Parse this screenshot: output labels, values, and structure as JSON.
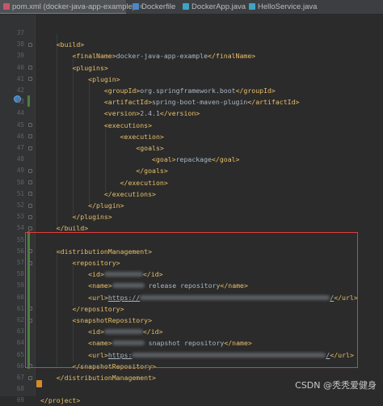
{
  "tabs": [
    {
      "label": "pom.xml (docker-java-app-example)",
      "icon": "maven-icon",
      "color": "#c7566b",
      "active": true
    },
    {
      "label": "Dockerfile",
      "icon": "docker-icon",
      "color": "#4a88c7",
      "active": false
    },
    {
      "label": "DockerApp.java",
      "icon": "java-class-icon",
      "color": "#3fa3c6",
      "active": false
    },
    {
      "label": "HelloService.java",
      "icon": "java-class-icon",
      "color": "#3fa3c6",
      "active": false
    }
  ],
  "close_glyph": "×",
  "editor": {
    "lines": [
      {
        "n": "37",
        "parts": []
      },
      {
        "n": "38",
        "parts": [
          {
            "t": "    "
          },
          {
            "tag": "<build>"
          }
        ]
      },
      {
        "n": "39",
        "parts": [
          {
            "t": "        "
          },
          {
            "tag": "<finalName>"
          },
          {
            "t": "docker-java-app-example"
          },
          {
            "tag": "</finalName>"
          }
        ]
      },
      {
        "n": "40",
        "parts": [
          {
            "t": "        "
          },
          {
            "tag": "<plugins>"
          }
        ]
      },
      {
        "n": "41",
        "parts": [
          {
            "t": "            "
          },
          {
            "tag": "<plugin>"
          }
        ]
      },
      {
        "n": "42",
        "parts": [
          {
            "t": "                "
          },
          {
            "tag": "<groupId>"
          },
          {
            "t": "org.springframework.boot"
          },
          {
            "tag": "</groupId>"
          }
        ]
      },
      {
        "n": "43",
        "parts": [
          {
            "t": "                "
          },
          {
            "tag": "<artifactId>"
          },
          {
            "t": "spring-boot-maven-plugin"
          },
          {
            "tag": "</artifactId>"
          }
        ]
      },
      {
        "n": "44",
        "parts": [
          {
            "t": "                "
          },
          {
            "tag": "<version>"
          },
          {
            "t": "2.4.1"
          },
          {
            "tag": "</version>"
          }
        ]
      },
      {
        "n": "45",
        "parts": [
          {
            "t": "                "
          },
          {
            "tag": "<executions>"
          }
        ]
      },
      {
        "n": "46",
        "parts": [
          {
            "t": "                    "
          },
          {
            "tag": "<execution>"
          }
        ]
      },
      {
        "n": "47",
        "parts": [
          {
            "t": "                        "
          },
          {
            "tag": "<goals>"
          }
        ]
      },
      {
        "n": "48",
        "parts": [
          {
            "t": "                            "
          },
          {
            "tag": "<goal>"
          },
          {
            "t": "repackage"
          },
          {
            "tag": "</goal>"
          }
        ]
      },
      {
        "n": "49",
        "parts": [
          {
            "t": "                        "
          },
          {
            "tag": "</goals>"
          }
        ]
      },
      {
        "n": "50",
        "parts": [
          {
            "t": "                    "
          },
          {
            "tag": "</execution>"
          }
        ]
      },
      {
        "n": "51",
        "parts": [
          {
            "t": "                "
          },
          {
            "tag": "</executions>"
          }
        ]
      },
      {
        "n": "52",
        "parts": [
          {
            "t": "            "
          },
          {
            "tag": "</plugin>"
          }
        ]
      },
      {
        "n": "53",
        "parts": [
          {
            "t": "        "
          },
          {
            "tag": "</plugins>"
          }
        ]
      },
      {
        "n": "54",
        "parts": [
          {
            "t": "    "
          },
          {
            "tag": "</build>"
          }
        ]
      },
      {
        "n": "55",
        "parts": []
      },
      {
        "n": "56",
        "parts": [
          {
            "t": "    "
          },
          {
            "tag": "<distributionManagement>"
          }
        ]
      },
      {
        "n": "57",
        "parts": [
          {
            "t": "        "
          },
          {
            "tag": "<repository>"
          }
        ]
      },
      {
        "n": "58",
        "parts": [
          {
            "t": "            "
          },
          {
            "tag": "<id>"
          },
          {
            "blur": 48
          },
          {
            "tag": "</id>"
          }
        ]
      },
      {
        "n": "59",
        "parts": [
          {
            "t": "            "
          },
          {
            "tag": "<name>"
          },
          {
            "blur": 40
          },
          {
            "t": " release repository"
          },
          {
            "tag": "</name>"
          }
        ]
      },
      {
        "n": "60",
        "parts": [
          {
            "t": "            "
          },
          {
            "tag": "<url>"
          },
          {
            "t": "https://",
            "u": true
          },
          {
            "blur": 235
          },
          {
            "t": "/",
            "u": true
          },
          {
            "tag": "</url>"
          }
        ]
      },
      {
        "n": "61",
        "parts": [
          {
            "t": "        "
          },
          {
            "tag": "</repository>"
          }
        ]
      },
      {
        "n": "62",
        "parts": [
          {
            "t": "        "
          },
          {
            "tag": "<snapshotRepository>"
          }
        ]
      },
      {
        "n": "63",
        "parts": [
          {
            "t": "            "
          },
          {
            "tag": "<id>"
          },
          {
            "blur": 48
          },
          {
            "tag": "</id>"
          }
        ]
      },
      {
        "n": "64",
        "parts": [
          {
            "t": "            "
          },
          {
            "tag": "<name>"
          },
          {
            "blur": 40
          },
          {
            "t": " snapshot repository"
          },
          {
            "tag": "</name>"
          }
        ]
      },
      {
        "n": "65",
        "parts": [
          {
            "t": "            "
          },
          {
            "tag": "<url>"
          },
          {
            "t": "https:",
            "u": true
          },
          {
            "blur": 240
          },
          {
            "t": "/",
            "u": true
          },
          {
            "tag": "</url>"
          }
        ]
      },
      {
        "n": "66",
        "parts": [
          {
            "t": "        "
          },
          {
            "tag": "</snapshotRepository>"
          }
        ]
      },
      {
        "n": "67",
        "parts": [
          {
            "t": "    "
          },
          {
            "tag": "</distributionManagement>"
          }
        ]
      },
      {
        "n": "68",
        "parts": []
      },
      {
        "n": "69",
        "parts": [
          {
            "tag": "</project>"
          }
        ]
      }
    ]
  },
  "watermark": "CSDN @秃秃爱健身",
  "colors": {
    "tag": "#e8bf6a",
    "text": "#a9b7c6",
    "background": "#2b2b2b",
    "highlight_box": "#e23b3b"
  }
}
